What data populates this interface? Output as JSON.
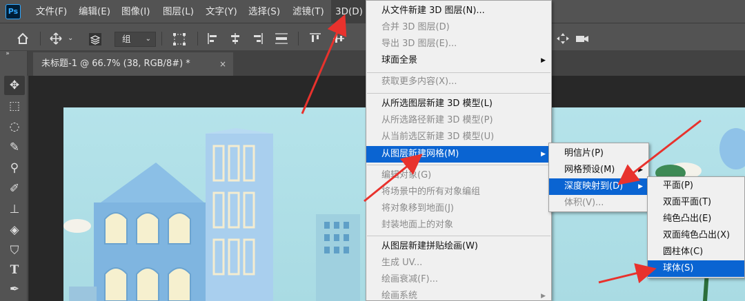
{
  "app": {
    "logo": "Ps"
  },
  "menubar": {
    "items": [
      "文件(F)",
      "编辑(E)",
      "图像(I)",
      "图层(L)",
      "文字(Y)",
      "选择(S)",
      "滤镜(T)",
      "3D(D)"
    ]
  },
  "options_bar": {
    "layer_select": "组",
    "icons": [
      "home-icon",
      "move-icon",
      "layers-stack-icon",
      "transform-controls-icon",
      "align-left-icon",
      "align-center-icon",
      "align-right-icon",
      "align-top-icon"
    ]
  },
  "document_tab": {
    "title": "未标题-1 @ 66.7% (38, RGB/8#) *",
    "close": "×"
  },
  "tools": [
    "move-tool",
    "marquee-tool",
    "lasso-tool",
    "quick-select-tool",
    "eyedropper-tool",
    "brush-tool",
    "stamp-tool",
    "eraser-tool",
    "paint-bucket-tool",
    "type-tool",
    "pen-tool"
  ],
  "menu_3d": {
    "items": [
      {
        "label": "从文件新建 3D 图层(N)...",
        "disabled": false
      },
      {
        "label": "合并 3D 图层(D)",
        "disabled": true
      },
      {
        "label": "导出 3D 图层(E)...",
        "disabled": true
      },
      {
        "label": "球面全景",
        "disabled": false,
        "submenu": true
      },
      {
        "label": "获取更多内容(X)...",
        "disabled": true
      },
      {
        "label": "从所选图层新建 3D 模型(L)",
        "disabled": false
      },
      {
        "label": "从所选路径新建 3D 模型(P)",
        "disabled": true
      },
      {
        "label": "从当前选区新建 3D 模型(U)",
        "disabled": true
      },
      {
        "label": "从图层新建网格(M)",
        "disabled": false,
        "submenu": true,
        "highlighted": true
      },
      {
        "label": "编辑对象(G)",
        "disabled": true
      },
      {
        "label": "将场景中的所有对象编组",
        "disabled": true
      },
      {
        "label": "将对象移到地面(J)",
        "disabled": true
      },
      {
        "label": "封装地面上的对象",
        "disabled": true
      },
      {
        "label": "从图层新建拼贴绘画(W)",
        "disabled": false
      },
      {
        "label": "生成 UV...",
        "disabled": true
      },
      {
        "label": "绘画衰减(F)...",
        "disabled": true
      },
      {
        "label": "绘画系统",
        "disabled": true,
        "submenu": true
      }
    ]
  },
  "submenu_mesh": {
    "items": [
      {
        "label": "明信片(P)",
        "disabled": false
      },
      {
        "label": "网格预设(M)",
        "disabled": false,
        "submenu": true
      },
      {
        "label": "深度映射到(D)",
        "disabled": false,
        "submenu": true,
        "highlighted": true
      },
      {
        "label": "体积(V)...",
        "disabled": true
      }
    ]
  },
  "submenu_depth": {
    "items": [
      {
        "label": "平面(P)",
        "highlighted": false
      },
      {
        "label": "双面平面(T)",
        "highlighted": false
      },
      {
        "label": "纯色凸出(E)",
        "highlighted": false
      },
      {
        "label": "双面纯色凸出(X)",
        "highlighted": false
      },
      {
        "label": "圆柱体(C)",
        "highlighted": false
      },
      {
        "label": "球体(S)",
        "highlighted": true
      }
    ]
  },
  "colors": {
    "menu_highlight": "#0a64d2",
    "annotation_arrow": "#e8322d",
    "ui_background": "#535353",
    "canvas_sky": "#b5e3ea"
  }
}
